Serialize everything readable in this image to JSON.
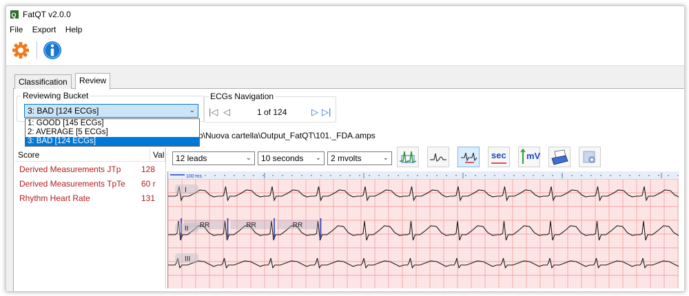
{
  "window": {
    "title": "FatQT v2.0.0"
  },
  "menu": [
    "File",
    "Export",
    "Help"
  ],
  "toolbar": {
    "settings_icon": "gear-icon",
    "info_icon": "info-icon"
  },
  "tabs": [
    {
      "label": "Classification"
    },
    {
      "label": "Review"
    }
  ],
  "reviewing_bucket": {
    "label": "Reviewing Bucket",
    "selected": "3: BAD [124 ECGs]",
    "options": [
      "1: GOOD [145 ECGs]",
      "2: AVERAGE [5 ECGs]",
      "3: BAD [124 ECGs]"
    ]
  },
  "navigation": {
    "label": "ECGs Navigation",
    "position": "1 of 124"
  },
  "file_path": "p\\Nuova cartella\\Output_FatQT\\101._FDA.amps",
  "measurements": {
    "headers": [
      "Score",
      "Val"
    ],
    "rows": [
      {
        "name": "Derived Measurements JTp",
        "value": "128"
      },
      {
        "name": "Derived Measurements TpTe",
        "value": "60 r"
      },
      {
        "name": "Rhythm Heart Rate",
        "value": "131"
      }
    ]
  },
  "ecg_controls": {
    "leads": "12 leads",
    "duration": "10 seconds",
    "amplitude": "2 mvolts",
    "tool_icons": [
      "heartbeat-marker-icon",
      "wave-icon",
      "beat-caliper-icon",
      "sec-icon",
      "mv-icon",
      "print-icon",
      "settings-icon"
    ],
    "sec_label": "sec",
    "mv_label": "mV"
  },
  "ecg": {
    "scale_label": "100 ms",
    "leads": [
      "I",
      "II",
      "III"
    ],
    "rr_labels": [
      "RR",
      "RR",
      "RR"
    ],
    "colors": {
      "grid_major": "#f2a0a0",
      "grid_minor": "#fbdada",
      "trace": "#1a1a1a",
      "marker": "#1f3fbf"
    }
  }
}
